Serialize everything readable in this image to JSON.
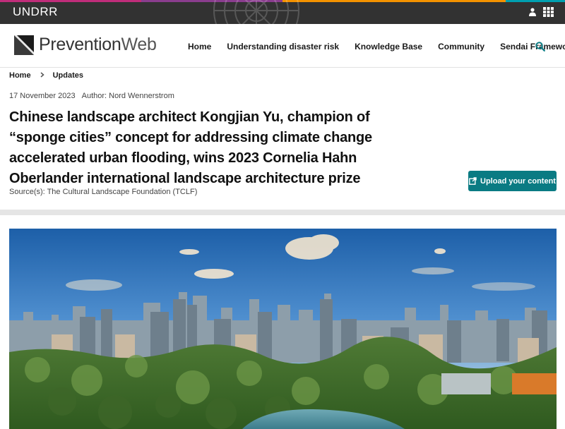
{
  "topbar": {
    "logo": "UNDRR",
    "stripe_colors": [
      "#c02d7a",
      "#8a3d8e",
      "#f39200",
      "#00a0b0"
    ],
    "icons": [
      "user-icon",
      "apps-grid-icon"
    ]
  },
  "header": {
    "brand_prefix": "Prevention",
    "brand_suffix": "Web",
    "nav": [
      "Home",
      "Understanding disaster risk",
      "Knowledge Base",
      "Community",
      "Sendai Framework"
    ],
    "search_icon": "search-icon"
  },
  "breadcrumb": {
    "items": [
      "Home",
      "Updates"
    ]
  },
  "article": {
    "date": "17 November 2023",
    "author": "Author: Nord Wennerstrom",
    "title": "Chinese landscape architect Kongjian Yu, champion of “sponge cities” concept for addressing climate change accelerated urban flooding, wins 2023 Cornelia Hahn Oberlander international landscape architecture prize",
    "source": "Source(s): The Cultural Landscape Foundation (TCLF)"
  },
  "actions": {
    "upload_label": "Upload your content"
  },
  "colors": {
    "accent": "#0a7b83",
    "topbar": "#323232"
  }
}
